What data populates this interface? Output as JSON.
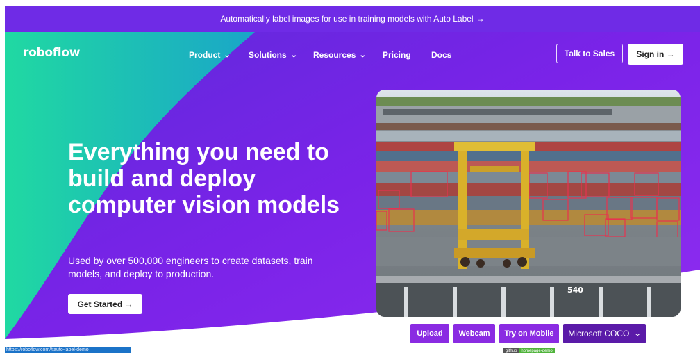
{
  "banner": {
    "text": "Automatically label images for use in training models with Auto Label",
    "arrow": "→"
  },
  "nav": {
    "logo": "roboflow",
    "items": [
      {
        "label": "Product",
        "dropdown": true
      },
      {
        "label": "Solutions",
        "dropdown": true
      },
      {
        "label": "Resources",
        "dropdown": true
      },
      {
        "label": "Pricing",
        "dropdown": false
      },
      {
        "label": "Docs",
        "dropdown": false
      }
    ],
    "talk_to_sales": "Talk to Sales",
    "sign_in": "Sign in →"
  },
  "hero": {
    "headline": "Everything you need to build and deploy computer vision models",
    "subtext": "Used by over 500,000 engineers to create datasets, train models, and deploy to production.",
    "cta": "Get Started →"
  },
  "demo": {
    "buttons": [
      "Upload",
      "Webcam",
      "Try on Mobile"
    ],
    "model_select": "Microsoft COCO",
    "image_label": "540"
  },
  "status_bar": {
    "url": "https://roboflow.com/#auto-label-demo"
  },
  "badge": {
    "left": "github",
    "right": "homepage-demo"
  },
  "colors": {
    "purple": "#6f2be6",
    "teal": "#1fd1a0",
    "button_purple": "#8a2be2",
    "select_purple": "#5a1aa8"
  }
}
